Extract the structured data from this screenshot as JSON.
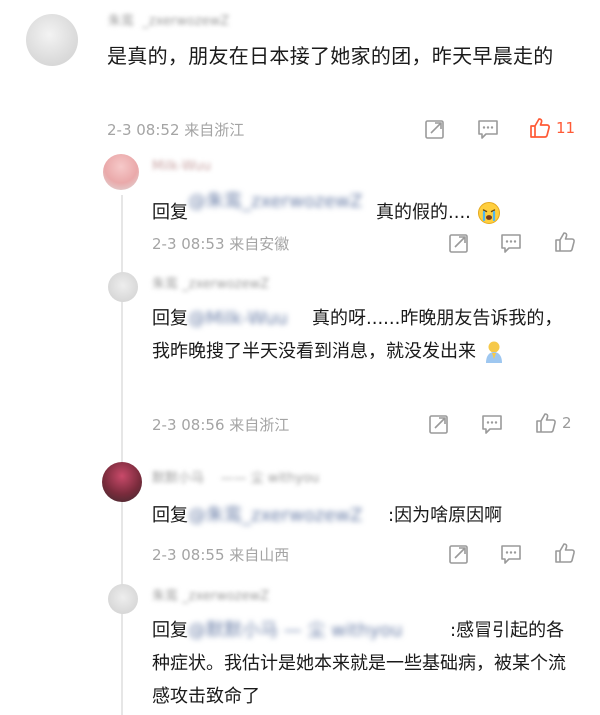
{
  "top": {
    "username": "朱鸾",
    "handle": "_zxerwozewZ",
    "text": "是真的，朋友在日本接了她家的团，昨天早晨走的",
    "time": "2-3 08:52 来自浙江",
    "likes": "11"
  },
  "replies": [
    {
      "username": "Milk-Wuu",
      "prefix": "回复",
      "mention": "@朱鸾_zxerwozewZ",
      "text": "真的假的....",
      "time": "2-3 08:53 来自安徽",
      "likes": ""
    },
    {
      "username": "朱鸾 _zxerwozewZ",
      "prefix": "回复",
      "mention": "@Milk-Wuu",
      "text": "真的呀......昨晚朋友告诉我的，我昨晚搜了半天没看到消息，就没发出来",
      "time": "2-3 08:56 来自浙江",
      "likes": "2"
    },
    {
      "username": "默默小马",
      "username_tail": "—— 尘 withyou",
      "prefix": "回复",
      "mention": "@朱鸾_zxerwozewZ",
      "text": ":因为啥原因啊",
      "time": "2-3 08:55 来自山西",
      "likes": ""
    },
    {
      "username": "朱鸾 _zxerwozewZ",
      "prefix": "回复",
      "mention": "@默默小马 — 尘 withyou",
      "text": ":感冒引起的各种症状。我估计是她本来就是一些基础病，被某个流感攻击致命了",
      "time": "",
      "likes": ""
    }
  ],
  "colors": {
    "meta": "#a4a4a4",
    "liked": "#ff5a36",
    "mention": "#6b7fa8"
  },
  "icons": [
    "share-icon",
    "comment-icon",
    "like-icon",
    "crying-emoji-icon",
    "pray-emoji-icon"
  ]
}
